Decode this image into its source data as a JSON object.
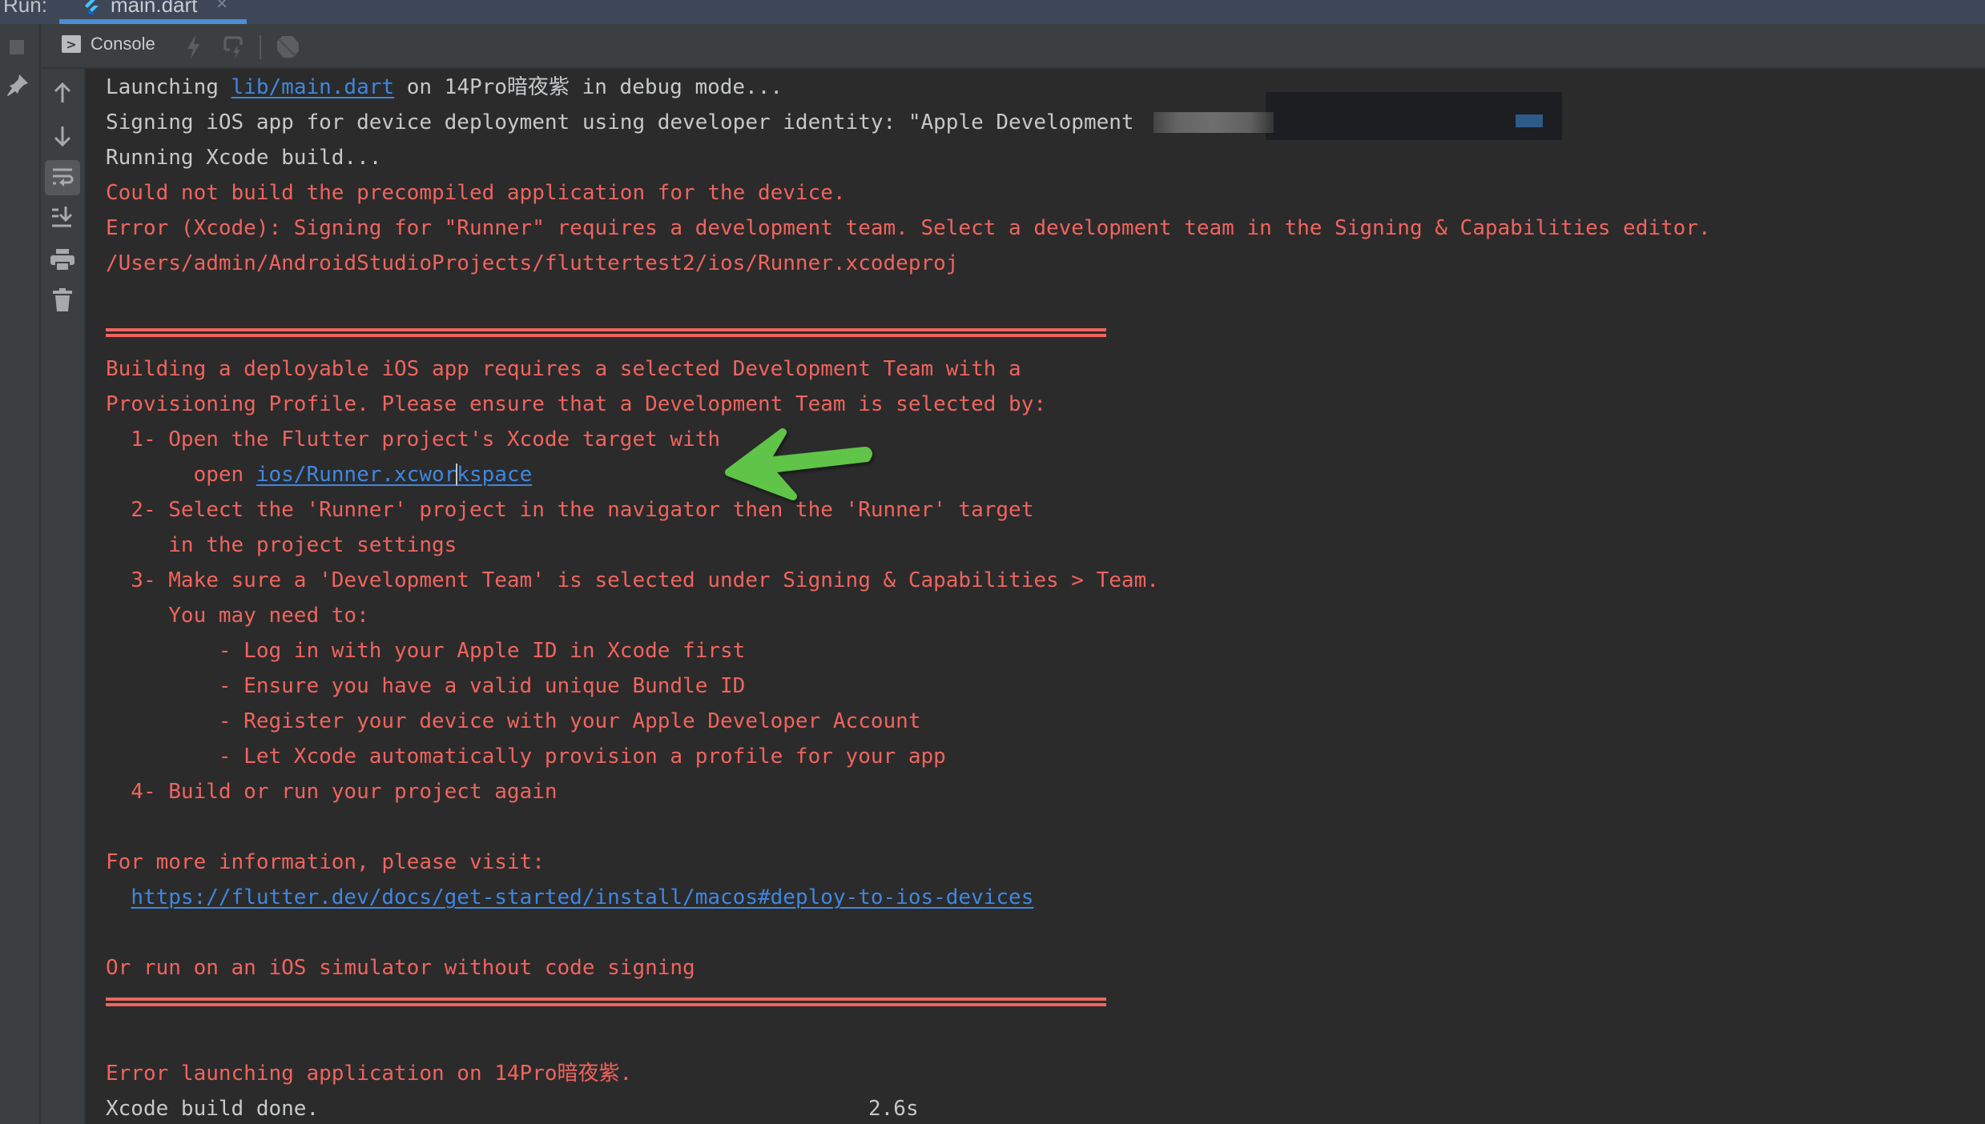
{
  "tabbar": {
    "run_label": "Run:",
    "tab_name": "main.dart",
    "close_glyph": "×",
    "accent_color": "#4a8fd6"
  },
  "toolbar": {
    "console_label": "Console",
    "console_icon_glyph": ">",
    "icons": [
      "hot-reload-icon",
      "hot-restart-icon",
      "dart-devtools-icon"
    ]
  },
  "left_column": {
    "icons": [
      "stop-icon",
      "pin-icon"
    ]
  },
  "side_toolbar": {
    "icons": [
      "up-arrow-icon",
      "down-arrow-icon",
      "soft-wrap-icon",
      "scroll-to-end-icon",
      "print-icon",
      "trash-icon"
    ]
  },
  "console": {
    "line1": {
      "prefix": "Launching ",
      "link": "lib/main.dart",
      "suffix": " on 14Pro暗夜紫 in debug mode..."
    },
    "line2": "Signing iOS app for device deployment using developer identity: \"Apple Development",
    "line3": "Running Xcode build...",
    "line4": "Could not build the precompiled application for the device.",
    "line5": "Error (Xcode): Signing for \"Runner\" requires a development team. Select a development team in the Signing & Capabilities editor.",
    "line6": "/Users/admin/AndroidStudioProjects/fluttertest2/ios/Runner.xcodeproj",
    "block": {
      "intro1": "Building a deployable iOS app requires a selected Development Team with a",
      "intro2": "Provisioning Profile. Please ensure that a Development Team is selected by:",
      "step1": "  1- Open the Flutter project's Xcode target with",
      "step1_open_prefix": "       open ",
      "step1_link_a": "ios/Runner.xcwor",
      "step1_link_b": "kspace",
      "step2a": "  2- Select the 'Runner' project in the navigator then the 'Runner' target",
      "step2b": "     in the project settings",
      "step3a": "  3- Make sure a 'Development Team' is selected under Signing & Capabilities > Team.",
      "step3b": "     You may need to:",
      "sub1": "         - Log in with your Apple ID in Xcode first",
      "sub2": "         - Ensure you have a valid unique Bundle ID",
      "sub3": "         - Register your device with your Apple Developer Account",
      "sub4": "         - Let Xcode automatically provision a profile for your app",
      "step4": "  4- Build or run your project again",
      "more_info": "For more information, please visit:",
      "url_indent": "  ",
      "url": "https://flutter.dev/docs/get-started/install/macos#deploy-to-ios-devices",
      "simulator": "Or run on an iOS simulator without code signing"
    },
    "error_launch": "Error launching application on 14Pro暗夜紫.",
    "build_done": "Xcode build done.",
    "build_time": "2.6s",
    "colors": {
      "normal": "#c6c8ca",
      "error": "#f0645e",
      "link": "#3f87e0",
      "background": "#2b2b2b"
    }
  },
  "annotation": {
    "type": "green-arrow",
    "color": "#5ec447",
    "points_to": "ios/Runner.xcworkspace"
  }
}
